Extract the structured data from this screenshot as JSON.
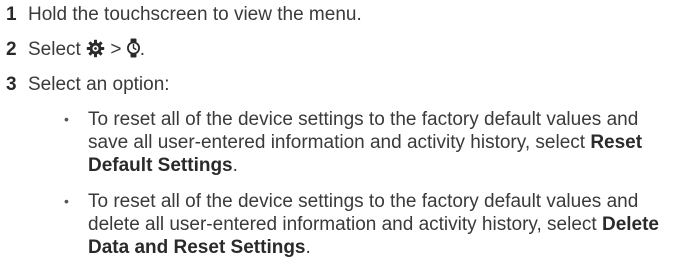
{
  "steps": [
    {
      "number": "1",
      "text": "Hold the touchscreen to view the menu."
    },
    {
      "number": "2",
      "prefix": "Select ",
      "icon1": "gear-icon",
      "separator": " > ",
      "icon2": "watch-icon",
      "suffix": "."
    },
    {
      "number": "3",
      "text": "Select an option:"
    }
  ],
  "options": [
    {
      "bullet": "•",
      "text": "To reset all of the device settings to the factory default values and save all user-entered information and activity history, select ",
      "bold": "Reset Default Settings",
      "end": "."
    },
    {
      "bullet": "•",
      "text": "To reset all of the device settings to the factory default values and delete all user-entered information and activity history, select ",
      "bold": "Delete Data and Reset Settings",
      "end": "."
    }
  ]
}
